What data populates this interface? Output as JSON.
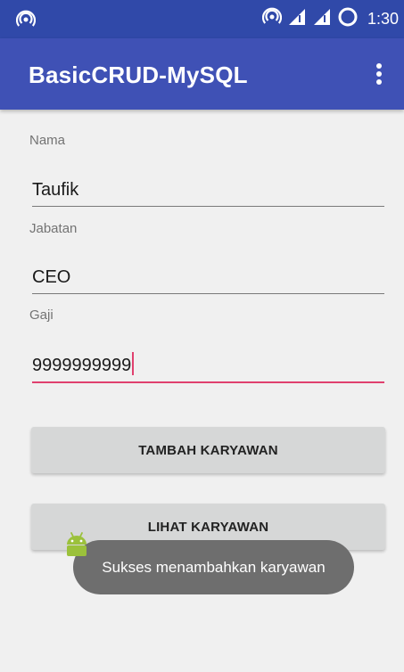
{
  "status_bar": {
    "time": "1:30",
    "icons": [
      "cast-icon",
      "cast-icon",
      "signal-icon",
      "signal-icon",
      "data-saver-icon"
    ]
  },
  "app_bar": {
    "title": "BasicCRUD-MySQL",
    "menu_icon": "more-vert-icon"
  },
  "form": {
    "nama": {
      "label": "Nama",
      "value": "Taufik"
    },
    "jabatan": {
      "label": "Jabatan",
      "value": "CEO"
    },
    "gaji": {
      "label": "Gaji",
      "value": "9999999999"
    }
  },
  "buttons": {
    "tambah": "TAMBAH KARYAWAN",
    "lihat": "LIHAT KARYAWAN"
  },
  "toast": {
    "message": "Sukses menambahkan karyawan",
    "icon": "android-icon"
  },
  "colors": {
    "status_bar": "#3049a9",
    "app_bar": "#3f51b5",
    "accent": "#e0406e",
    "background": "#f0f0f0",
    "button": "#d6d7d7",
    "toast": "#6e6e6e"
  }
}
